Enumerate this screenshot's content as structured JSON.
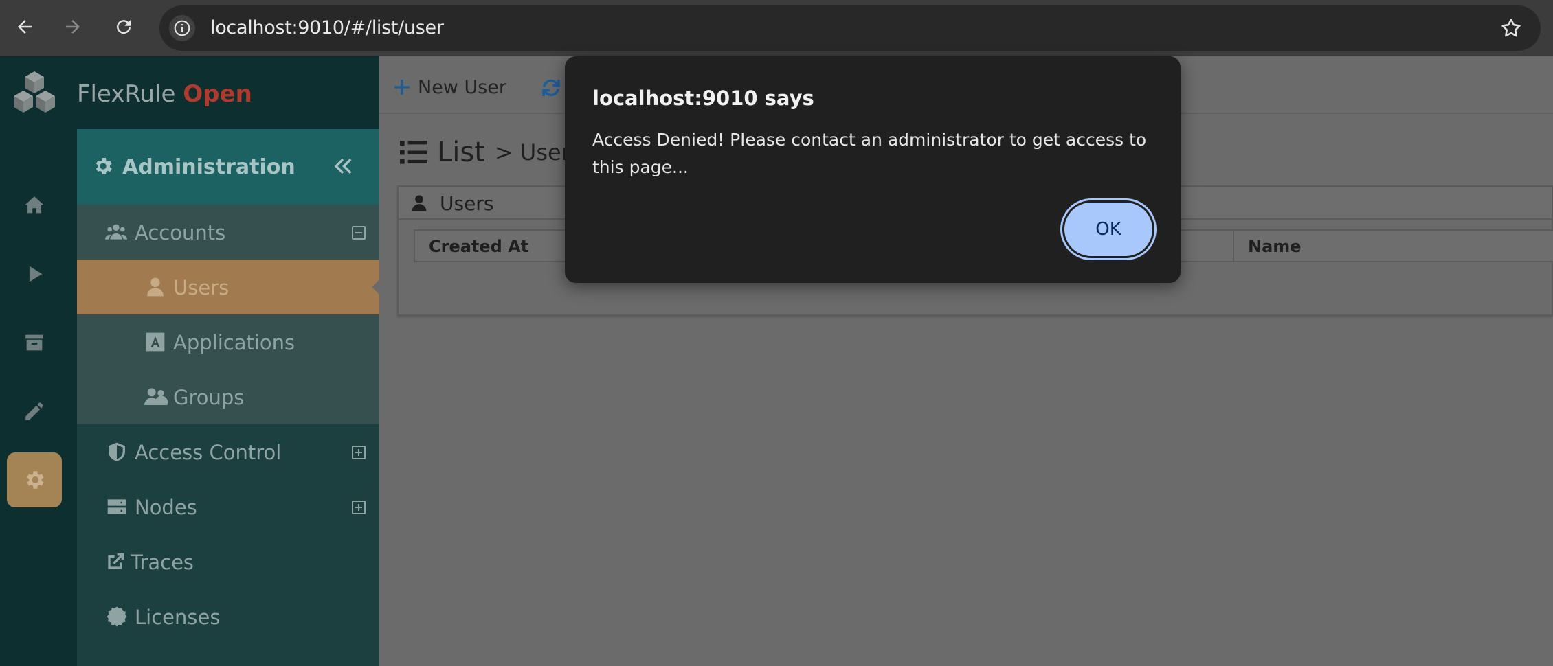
{
  "browser": {
    "url": "localhost:9010/#/list/user"
  },
  "brand": {
    "name": "FlexRule",
    "accent": "Open"
  },
  "rail": {
    "items": [
      "home-icon",
      "play-icon",
      "archive-icon",
      "pencil-icon",
      "gear-icon"
    ],
    "active": "gear-icon"
  },
  "sidebar": {
    "header": "Administration",
    "accounts_label": "Accounts",
    "users_label": "Users",
    "applications_label": "Applications",
    "groups_label": "Groups",
    "access_control_label": "Access Control",
    "nodes_label": "Nodes",
    "traces_label": "Traces",
    "licenses_label": "Licenses"
  },
  "toolbar": {
    "new_user_label": "New User",
    "refresh_icon": "refresh-icon"
  },
  "page": {
    "title": "List",
    "breadcrumb": "> Users",
    "panel_title": "Users",
    "columns": [
      "Created At",
      "",
      "Name"
    ]
  },
  "dialog": {
    "title": "localhost:9010 says",
    "message": "Access Denied! Please contact an administrator to get access to this page...",
    "ok_label": "OK"
  },
  "colors": {
    "accent_link": "#1b5d99",
    "brand_open": "#b03a2e",
    "selected_item": "#a17b4f",
    "dialog_button": "#a8c7fa"
  }
}
